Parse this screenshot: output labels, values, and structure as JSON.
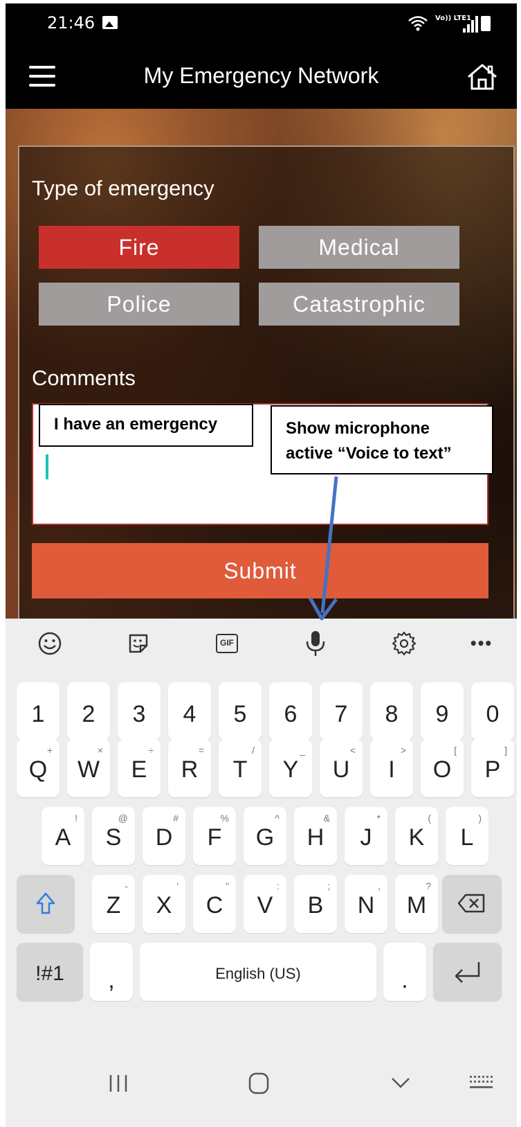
{
  "status": {
    "time": "21:46",
    "network": "Vo)) LTE1"
  },
  "header": {
    "title": "My Emergency Network"
  },
  "form": {
    "type_label": "Type of emergency",
    "types": [
      {
        "label": "Fire",
        "selected": true
      },
      {
        "label": "Medical",
        "selected": false
      },
      {
        "label": "Police",
        "selected": false
      },
      {
        "label": "Catastrophic",
        "selected": false
      }
    ],
    "comments_label": "Comments",
    "submit_label": "Submit",
    "colors": {
      "selected": "#c9302c",
      "unselected": "#a09c9c",
      "submit": "#df5b3a"
    }
  },
  "annotations": {
    "typed_text": "I have an emergency",
    "mic_note_line1": "Show microphone",
    "mic_note_line2": "active “Voice to text”"
  },
  "keyboard": {
    "toolbar": [
      "emoji-icon",
      "sticker-icon",
      "gif-icon",
      "microphone-icon",
      "settings-icon",
      "more-icon"
    ],
    "gif_label": "GIF",
    "more_label": "•••",
    "numbers": [
      "1",
      "2",
      "3",
      "4",
      "5",
      "6",
      "7",
      "8",
      "9",
      "0"
    ],
    "row1": [
      {
        "k": "Q",
        "s": "+"
      },
      {
        "k": "W",
        "s": "×"
      },
      {
        "k": "E",
        "s": "÷"
      },
      {
        "k": "R",
        "s": "="
      },
      {
        "k": "T",
        "s": "/"
      },
      {
        "k": "Y",
        "s": "_"
      },
      {
        "k": "U",
        "s": "<"
      },
      {
        "k": "I",
        "s": ">"
      },
      {
        "k": "O",
        "s": "["
      },
      {
        "k": "P",
        "s": "]"
      }
    ],
    "row2": [
      {
        "k": "A",
        "s": "!"
      },
      {
        "k": "S",
        "s": "@"
      },
      {
        "k": "D",
        "s": "#"
      },
      {
        "k": "F",
        "s": "%"
      },
      {
        "k": "G",
        "s": "^"
      },
      {
        "k": "H",
        "s": "&"
      },
      {
        "k": "J",
        "s": "*"
      },
      {
        "k": "K",
        "s": "("
      },
      {
        "k": "L",
        "s": ")"
      }
    ],
    "row3": [
      {
        "k": "Z",
        "s": "-"
      },
      {
        "k": "X",
        "s": "'"
      },
      {
        "k": "C",
        "s": "\""
      },
      {
        "k": "V",
        "s": ":"
      },
      {
        "k": "B",
        "s": ";"
      },
      {
        "k": "N",
        "s": ","
      },
      {
        "k": "M",
        "s": "?"
      }
    ],
    "symbols_label": "!#1",
    "comma_label": ",",
    "space_label": "English (US)",
    "period_label": "."
  }
}
